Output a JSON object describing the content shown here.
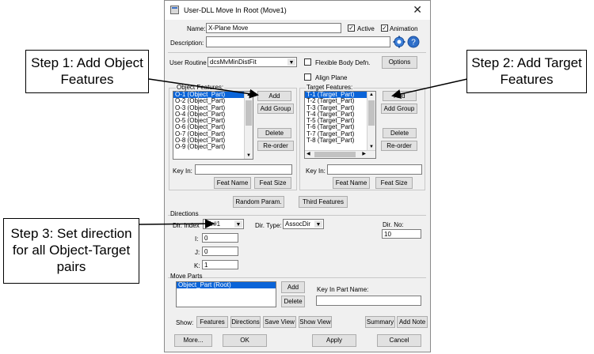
{
  "window": {
    "title": "User-DLL Move In Root (Move1)"
  },
  "name": {
    "label": "Name:",
    "value": "X-Plane Move"
  },
  "active": {
    "label": "Active",
    "checked": true
  },
  "animation": {
    "label": "Animation",
    "checked": true
  },
  "description": {
    "label": "Description:",
    "value": ""
  },
  "icons": [
    "gear-icon",
    "help-icon"
  ],
  "user_routine": {
    "label": "User Routine",
    "value": "dcsMvMinDistFit"
  },
  "flexible_body": {
    "label": "Flexible Body Defn.",
    "checked": false
  },
  "options_button": "Options",
  "align_plane": {
    "label": "Align Plane",
    "checked": false
  },
  "object_features": {
    "label": "Object Features:",
    "items": [
      "O-1 (Object_Part)",
      "O-2 (Object_Part)",
      "O-3 (Object_Part)",
      "O-4 (Object_Part)",
      "O-5 (Object_Part)",
      "O-6 (Object_Part)",
      "O-7 (Object_Part)",
      "O-8 (Object_Part)",
      "O-9 (Object_Part)"
    ],
    "selected": 0,
    "add": "Add",
    "add_group": "Add Group",
    "delete": "Delete",
    "reorder": "Re-order",
    "key_in_label": "Key In:",
    "feat_name": "Feat Name",
    "feat_size": "Feat Size"
  },
  "target_features": {
    "label": "Target Features:",
    "items": [
      "T-1 (Target_Part)",
      "T-2 (Target_Part)",
      "T-3 (Target_Part)",
      "T-4 (Target_Part)",
      "T-5 (Target_Part)",
      "T-6 (Target_Part)",
      "T-7 (Target_Part)",
      "T-8 (Target_Part)"
    ],
    "selected": 0,
    "add": "Add",
    "add_group": "Add Group",
    "delete": "Delete",
    "reorder": "Re-order",
    "key_in_label": "Key In:",
    "feat_name": "Feat Name",
    "feat_size": "Feat Size"
  },
  "random_param": "Random Param.",
  "third_features": "Third Features",
  "directions": {
    "label": "Directions",
    "dir_index_label": "Dir. Index",
    "dir_index_value": "Dir#1",
    "dir_type_label": "Dir. Type:",
    "dir_type_value": "AssocDir",
    "dir_no_label": "Dir. No:",
    "dir_no_value": "10",
    "i_label": "I:",
    "i_value": "0",
    "j_label": "J:",
    "j_value": "0",
    "k_label": "K:",
    "k_value": "1"
  },
  "move_parts": {
    "label": "Move Parts",
    "items": [
      "Object_Part (Root)"
    ],
    "add": "Add",
    "delete": "Delete",
    "key_in_label": "Key In Part Name:"
  },
  "show": {
    "label": "Show:",
    "features": "Features",
    "directions": "Directions",
    "save_view": "Save View",
    "show_view": "Show View",
    "summary": "Summary",
    "add_note": "Add Note"
  },
  "bottom": {
    "more": "More...",
    "ok": "OK",
    "apply": "Apply",
    "cancel": "Cancel"
  },
  "callouts": {
    "step1": "Step 1: Add Object Features",
    "step2": "Step 2: Add Target Features",
    "step3": "Step 3: Set direction for all Object-Target pairs"
  },
  "accent_color": "#0a64d8"
}
